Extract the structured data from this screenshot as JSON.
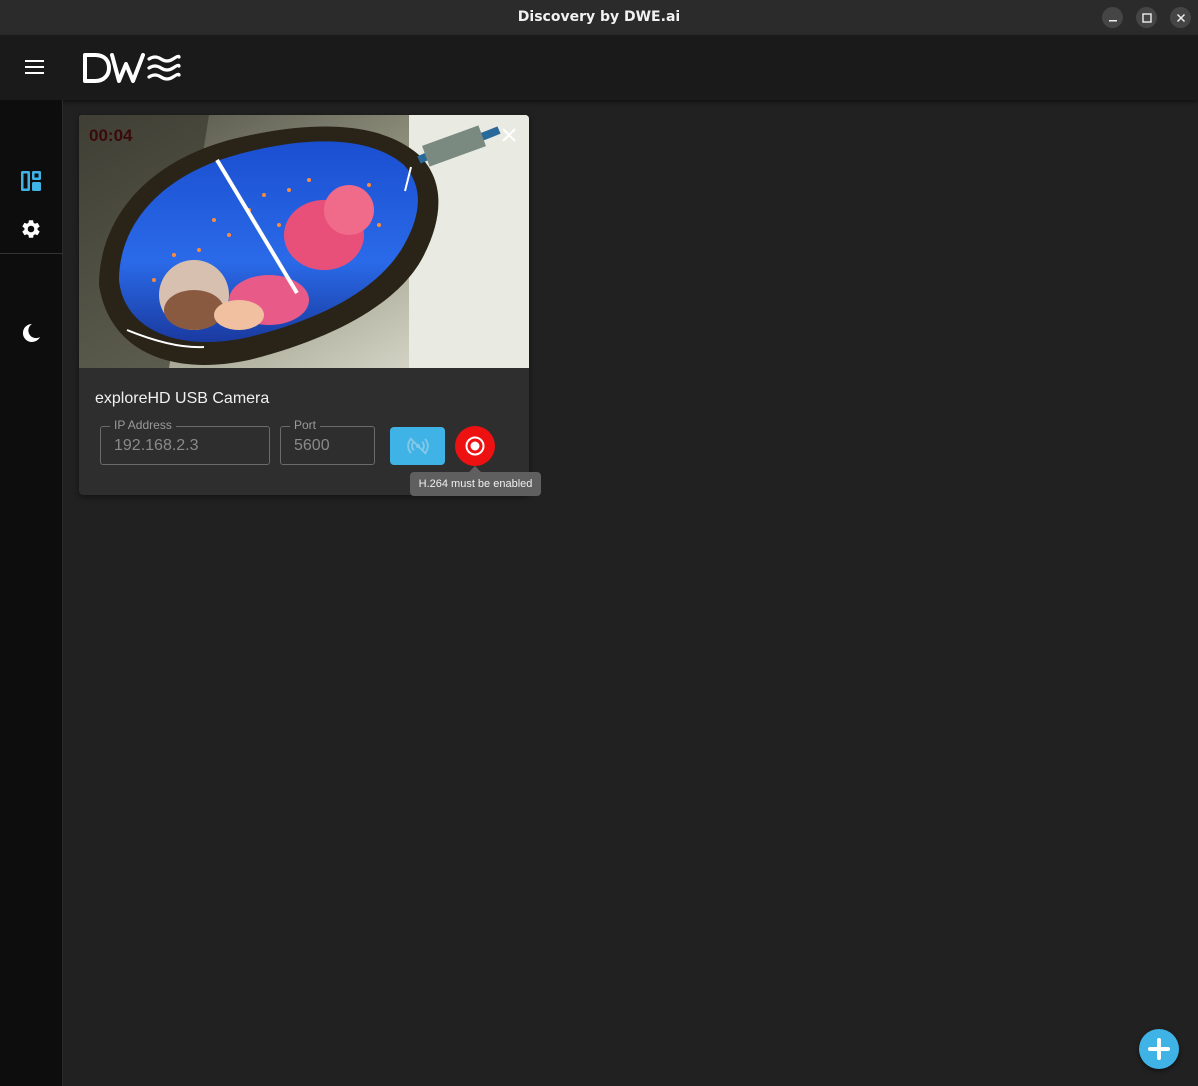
{
  "window": {
    "title": "Discovery by DWE.ai"
  },
  "app": {
    "logo_text": "DW≋"
  },
  "sidebar": {
    "items": [
      {
        "name": "dashboard",
        "icon": "dashboard-icon",
        "active": true
      },
      {
        "name": "settings",
        "icon": "gear-icon",
        "active": false
      },
      {
        "name": "theme",
        "icon": "moon-icon",
        "active": false
      }
    ]
  },
  "camera_card": {
    "timer": "00:04",
    "camera_name": "exploreHD USB Camera",
    "ip_address": {
      "label": "IP Address",
      "value": "192.168.2.3"
    },
    "port": {
      "label": "Port",
      "value": "5600"
    },
    "stream_button_icon": "stream-off-icon",
    "record_button_icon": "record-icon",
    "tooltip": "H.264 must be enabled"
  },
  "fab": {
    "icon": "plus-icon"
  },
  "colors": {
    "accent": "#40b3e6",
    "record": "#ee1111"
  }
}
